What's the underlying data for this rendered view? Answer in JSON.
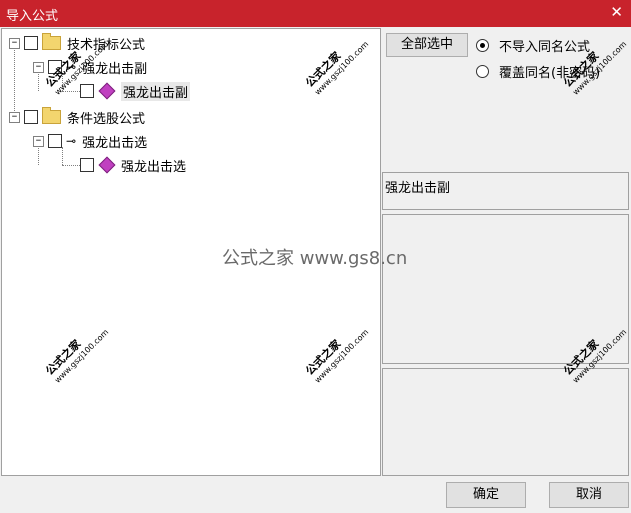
{
  "window": {
    "title": "导入公式",
    "close_glyph": "✕"
  },
  "tree": {
    "items": [
      {
        "label": "技术指标公式",
        "type": "folder"
      },
      {
        "label": "强龙出击副",
        "type": "key"
      },
      {
        "label": "强龙出击副",
        "type": "formula"
      },
      {
        "label": "条件选股公式",
        "type": "folder"
      },
      {
        "label": "强龙出击选",
        "type": "key"
      },
      {
        "label": "强龙出击选",
        "type": "formula"
      }
    ]
  },
  "toolbar": {
    "select_all": "全部选中"
  },
  "options": {
    "no_import_same": "不导入同名公式",
    "overwrite_same": "覆盖同名(非密码)",
    "selected": "no_import_same"
  },
  "preview": {
    "name": "强龙出击副"
  },
  "watermark": {
    "brand": "公式之家",
    "url": "www.gszj100.com",
    "center": "公式之家 www.gs8.cn"
  },
  "footer": {
    "ok": "确定",
    "cancel": "取消"
  }
}
